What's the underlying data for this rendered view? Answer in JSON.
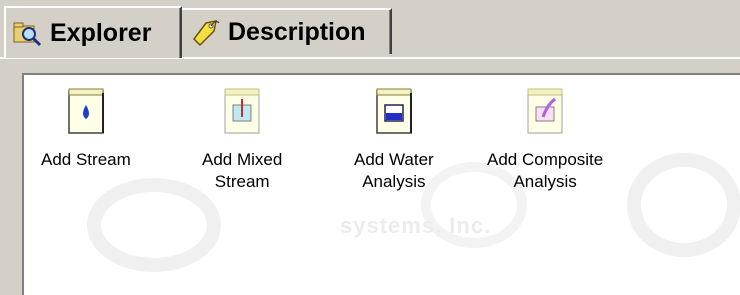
{
  "tabs": [
    {
      "label": "Explorer",
      "icon": "magnifier-folder-icon",
      "active": true
    },
    {
      "label": "Description",
      "icon": "tag-icon",
      "active": false
    }
  ],
  "items": [
    {
      "label": "Add Stream",
      "icon": "water-drop-page-icon"
    },
    {
      "label": "Add Mixed\nStream",
      "icon": "mixing-beaker-page-icon"
    },
    {
      "label": "Add Water\nAnalysis",
      "icon": "water-analysis-beaker-page-icon"
    },
    {
      "label": "Add Composite\nAnalysis",
      "icon": "composite-flask-page-icon"
    }
  ],
  "watermark": "systems, Inc."
}
